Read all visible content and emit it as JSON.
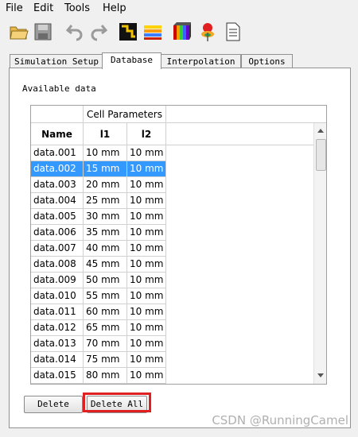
{
  "menu": {
    "file": "File",
    "edit": "Edit",
    "tools": "Tools",
    "help": "Help"
  },
  "tabs": [
    "Simulation Setup",
    "Database",
    "Interpolation",
    "Options"
  ],
  "available_label": "Available data",
  "table": {
    "group_header": "Cell Parameters",
    "columns": [
      "Name",
      "l1",
      "l2"
    ],
    "selected_row": 1,
    "rows": [
      [
        "data.001",
        "10 mm",
        "10 mm"
      ],
      [
        "data.002",
        "15 mm",
        "10 mm"
      ],
      [
        "data.003",
        "20 mm",
        "10 mm"
      ],
      [
        "data.004",
        "25 mm",
        "10 mm"
      ],
      [
        "data.005",
        "30 mm",
        "10 mm"
      ],
      [
        "data.006",
        "35 mm",
        "10 mm"
      ],
      [
        "data.007",
        "40 mm",
        "10 mm"
      ],
      [
        "data.008",
        "45 mm",
        "10 mm"
      ],
      [
        "data.009",
        "50 mm",
        "10 mm"
      ],
      [
        "data.010",
        "55 mm",
        "10 mm"
      ],
      [
        "data.011",
        "60 mm",
        "10 mm"
      ],
      [
        "data.012",
        "65 mm",
        "10 mm"
      ],
      [
        "data.013",
        "70 mm",
        "10 mm"
      ],
      [
        "data.014",
        "75 mm",
        "10 mm"
      ],
      [
        "data.015",
        "80 mm",
        "10 mm"
      ]
    ]
  },
  "buttons": {
    "delete": "Delete",
    "delete_all": "Delete All"
  },
  "watermark": "CSDN @RunningCamel",
  "colors": {
    "selection": "#3399ff",
    "highlight": "#e02020"
  }
}
